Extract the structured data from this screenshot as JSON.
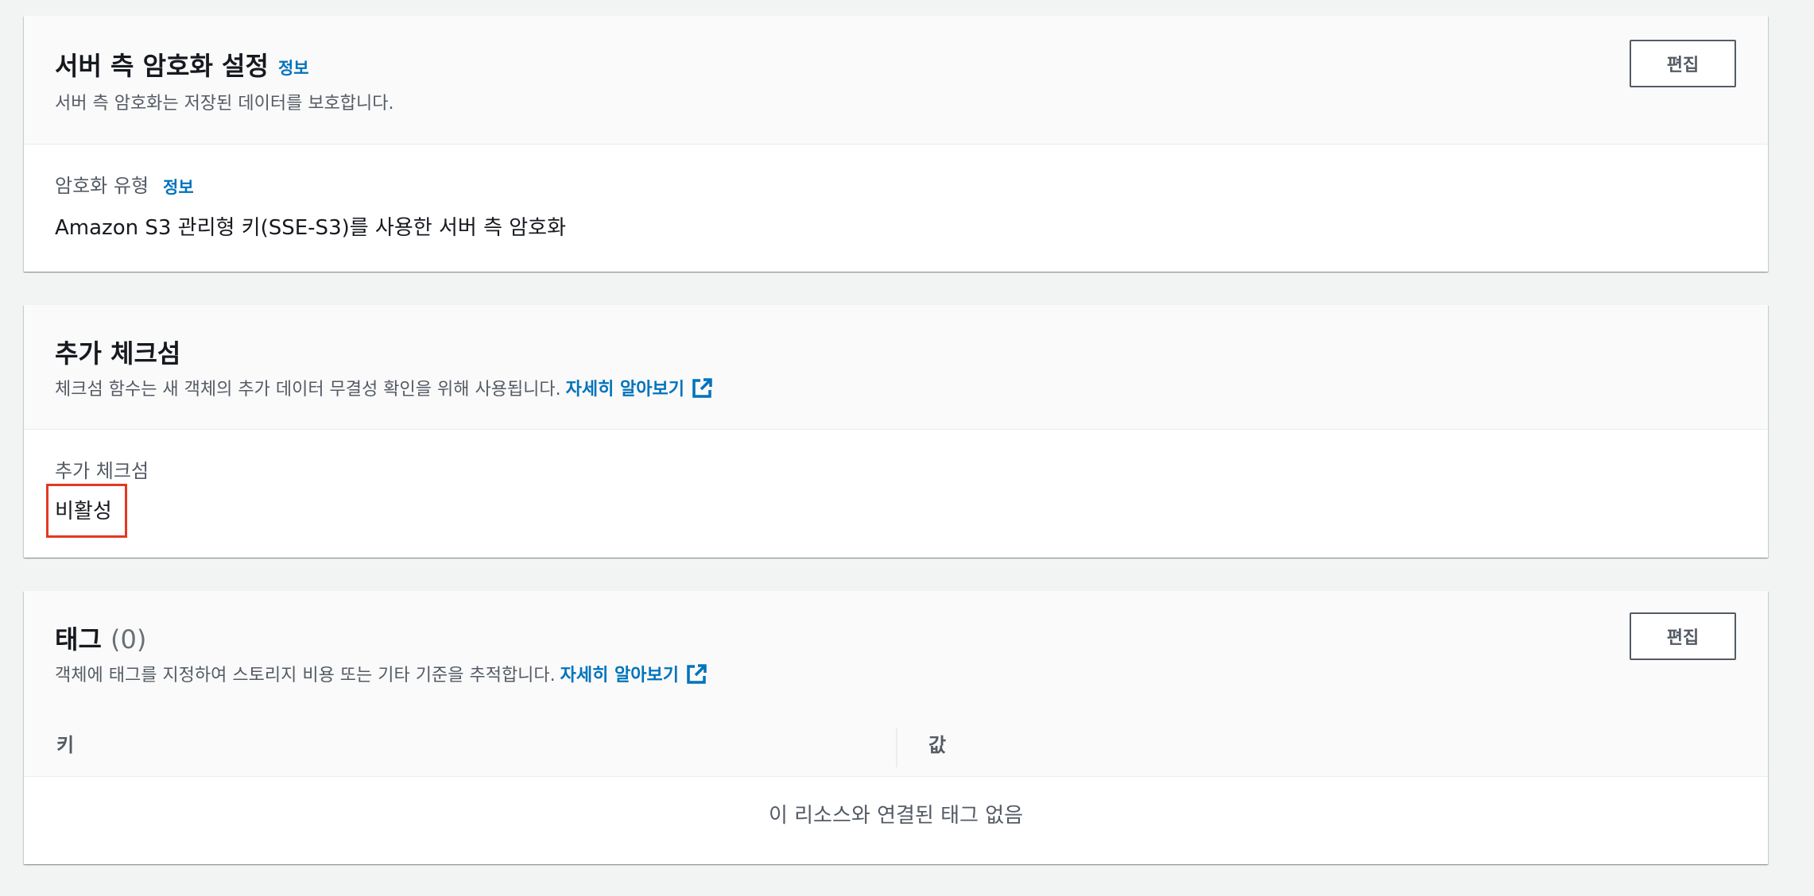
{
  "encryption": {
    "title": "서버 측 암호화 설정",
    "info_link": "정보",
    "description": "서버 측 암호화는 저장된 데이터를 보호합니다.",
    "edit_label": "편집",
    "field_label": "암호화 유형",
    "field_info_link": "정보",
    "field_value": "Amazon S3 관리형 키(SSE-S3)를 사용한 서버 측 암호화"
  },
  "checksum": {
    "title": "추가 체크섬",
    "description": "체크섬 함수는 새 객체의 추가 데이터 무결성 확인을 위해 사용됩니다.",
    "learn_more": "자세히 알아보기",
    "field_label": "추가 체크섬",
    "field_value": "비활성"
  },
  "tags": {
    "title": "태그",
    "count": "(0)",
    "description": "객체에 태그를 지정하여 스토리지 비용 또는 기타 기준을 추적합니다.",
    "learn_more": "자세히 알아보기",
    "edit_label": "편집",
    "columns": [
      "키",
      "값"
    ],
    "empty_message": "이 리소스와 연결된 태그 없음"
  },
  "colors": {
    "link": "#0073bb",
    "highlight": "#e3391f",
    "background": "#f2f3f3"
  },
  "icons": {
    "external_link": "external-link-icon"
  }
}
